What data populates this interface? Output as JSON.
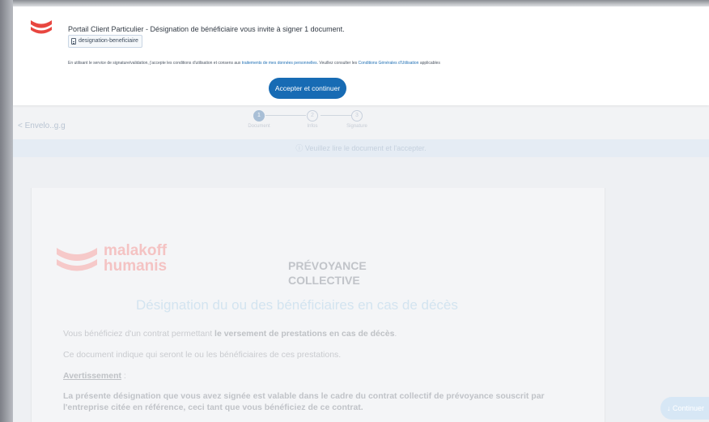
{
  "modal": {
    "message": "Portail Client Particulier - Désignation de bénéficiaire vous invite à signer 1 document.",
    "document_name": "designation-beneficiaire",
    "terms": {
      "part1": "En utilisant le service de signature/validation, j'accepte les conditions d'utilisation et consens aux",
      "link1": "traitements de mes données personnelles",
      "part2": ". Veuillez consulter les",
      "link2": "Conditions Générales d'Utilisation",
      "part3": "applicables"
    },
    "accept_button": "Accepter et continuer",
    "accent_color": "#176bb4"
  },
  "stepper": {
    "back_label": "< Envelo..g.g",
    "steps": [
      {
        "number": "1",
        "label": "Document"
      },
      {
        "number": "2",
        "label": "Infos"
      },
      {
        "number": "3",
        "label": "Signature"
      }
    ]
  },
  "notice": "ⓘ Veuillez lire le document et l'accepter.",
  "document": {
    "logo_line1": "malakoff",
    "logo_line2": "humanis",
    "header_line1": "PRÉVOYANCE",
    "header_line2": "COLLECTIVE",
    "title": "Désignation du ou des bénéficiaires en cas de décès",
    "para1_prefix": "Vous bénéficiez d'un contrat permettant",
    "para1_bold": "le versement de prestations en cas de décès",
    "para1_suffix": ".",
    "para2": "Ce document indique qui seront le ou les bénéficiaires de ces prestations.",
    "warning_heading": "Avertissement",
    "warning_suffix": ":",
    "para3": "La présente désignation que vous avez signée est valable dans le cadre du contrat collectif de prévoyance souscrit par l'entreprise citée en référence, ceci tant que vous bénéficiez de ce contrat."
  },
  "continue_button": "↓ Continuer"
}
